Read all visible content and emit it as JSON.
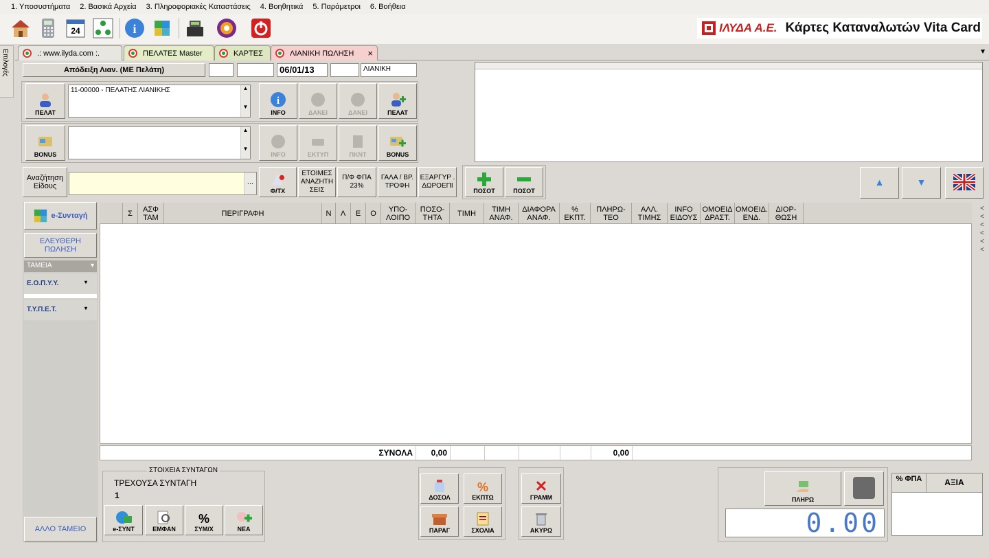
{
  "menu": [
    "1. Υποσυστήματα",
    "2. Βασικά Αρχεία",
    "3. Πληροφοριακές Καταστάσεις",
    "4. Βοηθητικά",
    "5. Παράμετροι",
    "6. Βοήθεια"
  ],
  "brand": {
    "logo": "ΙΛΥΔΑ Α.Ε.",
    "title": "Κάρτες Καταναλωτών Vita Card"
  },
  "side_strip": "Επιλογές",
  "tabs": [
    {
      "label": ".: www.ilyda.com :."
    },
    {
      "label": "ΠΕΛΑΤΕΣ Master"
    },
    {
      "label": "ΚΑΡΤΕΣ"
    },
    {
      "label": "ΛΙΑΝΙΚΗ ΠΩΛΗΣΗ",
      "close": "×"
    }
  ],
  "header": {
    "doc_type": "Απόδειξη Λιαν. (ΜΕ Πελάτη)",
    "date": "06/01/13",
    "mode": "ΛΙΑΝΙΚΗ"
  },
  "customer": {
    "btn_label": "ΠΕΛΑΤ",
    "value": "11-00000 - ΠΕΛΑΤΗΣ ΛΙΑΝΙΚΗΣ",
    "info": "INFO",
    "loan1": "ΔΑΝΕΙ",
    "loan2": "ΔΑΝΕΙ",
    "new": "ΠΕΛΑΤ"
  },
  "bonus": {
    "btn_label": "BONUS",
    "info": "INFO",
    "print": "ΕΚΤΥΠ",
    "point": "ΠΚΝΤ",
    "new": "BONUS"
  },
  "search": {
    "label": "Αναζήτηση Είδους",
    "dots": "...",
    "fptx": "Φ/ΤΧ",
    "ready": "ΕΤΟΙΜΕΣ ΑΝΑΖΗΤΗ ΣΕΙΣ",
    "pf": "Π/Φ ΦΠΑ 23%",
    "milk": "ΓΑΛΑ / ΒΡ. ΤΡΟΦΗ",
    "redeem": "ΕΞΑΡΓΥΡ . ΔΩΡΟΕΠΙ",
    "qty_plus": "ΠΟΣΟΤ",
    "qty_minus": "ΠΟΣΟΤ"
  },
  "columns": [
    "Σ",
    "ΑΣΦ ΤΑΜ",
    "ΠΕΡΙΓΡΑΦΗ",
    "Ν",
    "Λ",
    "Ε",
    "Ο",
    "ΥΠΟ- ΛΟΙΠΟ",
    "ΠΟΣΟ- ΤΗΤΑ",
    "ΤΙΜΗ",
    "ΤΙΜΗ ΑΝΑΦ.",
    "ΔΙΑΦΟΡΑ ΑΝΑΦ.",
    "% ΕΚΠΤ.",
    "ΠΛΗΡΩ- ΤΕΟ",
    "ΑΛΛ. ΤΙΜΗΣ",
    "INFO ΕΙΔΟΥΣ",
    "ΟΜΟΕΙΔ ΔΡΑΣΤ.",
    "ΟΜΟΕΙΔ. ΕΝΔ.",
    "ΔΙΟΡ- ΘΩΣΗ"
  ],
  "totals": {
    "label": "ΣΥΝΟΛΑ",
    "qty": "0,00",
    "payable": "0,00"
  },
  "left": {
    "esyntagi": "e-Συνταγή",
    "free_sale": "ΕΛΕΥΘΕΡΗ ΠΩΛΗΣΗ",
    "funds_header": "ΤΑΜΕΙΑ",
    "fund1": "Ε.Ο.Π.Υ.Υ.",
    "fund2": "Τ.Υ.Π.Ε.Τ.",
    "other_fund": "ΑΛΛΟ ΤΑΜΕΙΟ"
  },
  "prescriptions": {
    "title": "ΣΤΟΙΧΕΙΑ ΣΥΝΤΑΓΩΝ",
    "current_label": "ΤΡΕΧΟΥΣΑ ΣΥΝΤΑΓΗ",
    "current_value": "1",
    "b1": "e-ΣΥΝΤ",
    "b2": "ΕΜΦΑΝ",
    "b3": "ΣΥΜ/Χ",
    "b4": "ΝΕΑ"
  },
  "actions": {
    "dosol": "ΔΟΣΟΛ",
    "ekpt": "ΕΚΠΤΩ",
    "parag": "ΠΑΡΑΓ",
    "sxolia": "ΣΧΟΛΙΑ",
    "gramm": "ΓΡΑΜΜ",
    "akyro": "ΑΚΥΡΩ"
  },
  "payment": {
    "pay": "ΠΛΗΡΩ",
    "display": "0.00",
    "vat_col": "% ΦΠΑ",
    "value_col": "ΑΞΙΑ"
  }
}
